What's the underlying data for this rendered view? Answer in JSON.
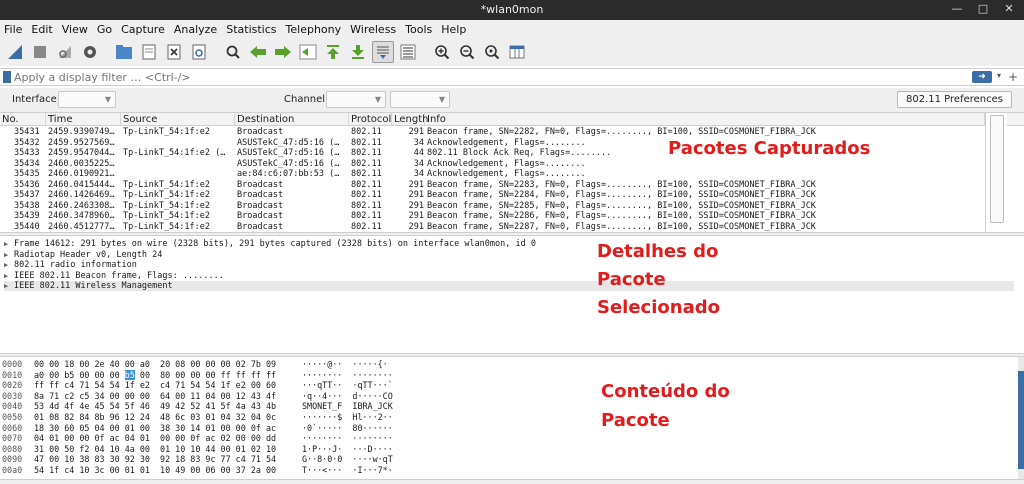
{
  "window": {
    "title": "*wlan0mon"
  },
  "window_controls": {
    "minimize": "—",
    "maximize": "□",
    "close": "✕"
  },
  "menu": [
    "File",
    "Edit",
    "View",
    "Go",
    "Capture",
    "Analyze",
    "Statistics",
    "Telephony",
    "Wireless",
    "Tools",
    "Help"
  ],
  "toolbar_icons": [
    "shark-fin-start-icon",
    "stop-icon",
    "restart-icon",
    "options-gear-icon",
    "open-folder-icon",
    "save-icon",
    "close-file-icon",
    "reload-icon",
    "find-icon",
    "back-arrow-icon",
    "forward-arrow-icon",
    "goto-packet-icon",
    "first-packet-icon",
    "last-packet-icon",
    "autoscroll-icon",
    "colorize-icon",
    "zoom-in-icon",
    "zoom-out-icon",
    "zoom-normal-icon",
    "resize-columns-icon"
  ],
  "filter": {
    "placeholder": "Apply a display filter … <Ctrl-/>",
    "value": ""
  },
  "wireless_toolbar": {
    "interface_label": "Interface",
    "channel_label": "Channel",
    "preferences_label": "802.11 Preferences"
  },
  "packet_list": {
    "columns": [
      "No.",
      "Time",
      "Source",
      "Destination",
      "Protocol",
      "Length",
      "Info"
    ],
    "rows": [
      [
        "35431",
        "2459.9390749…",
        "Tp-LinkT_54:1f:e2",
        "Broadcast",
        "802.11",
        "291",
        "Beacon frame, SN=2282, FN=0, Flags=........, BI=100, SSID=COSMONET_FIBRA_JCK"
      ],
      [
        "35432",
        "2459.9527569…",
        "",
        "ASUSTekC_47:d5:16 (…",
        "802.11",
        "34",
        "Acknowledgement, Flags=........"
      ],
      [
        "35433",
        "2459.9547044…",
        "Tp-LinkT_54:1f:e2 (…",
        "ASUSTekC_47:d5:16 (…",
        "802.11",
        "44",
        "802.11 Block Ack Req, Flags=........"
      ],
      [
        "35434",
        "2460.0035225…",
        "",
        "ASUSTekC_47:d5:16 (…",
        "802.11",
        "34",
        "Acknowledgement, Flags=........"
      ],
      [
        "35435",
        "2460.0190921…",
        "",
        "ae:84:c6:07:bb:53 (…",
        "802.11",
        "34",
        "Acknowledgement, Flags=........"
      ],
      [
        "35436",
        "2460.0415444…",
        "Tp-LinkT_54:1f:e2",
        "Broadcast",
        "802.11",
        "291",
        "Beacon frame, SN=2283, FN=0, Flags=........, BI=100, SSID=COSMONET_FIBRA_JCK"
      ],
      [
        "35437",
        "2460.1426469…",
        "Tp-LinkT_54:1f:e2",
        "Broadcast",
        "802.11",
        "291",
        "Beacon frame, SN=2284, FN=0, Flags=........, BI=100, SSID=COSMONET_FIBRA_JCK"
      ],
      [
        "35438",
        "2460.2463308…",
        "Tp-LinkT_54:1f:e2",
        "Broadcast",
        "802.11",
        "291",
        "Beacon frame, SN=2285, FN=0, Flags=........, BI=100, SSID=COSMONET_FIBRA_JCK"
      ],
      [
        "35439",
        "2460.3478960…",
        "Tp-LinkT_54:1f:e2",
        "Broadcast",
        "802.11",
        "291",
        "Beacon frame, SN=2286, FN=0, Flags=........, BI=100, SSID=COSMONET_FIBRA_JCK"
      ],
      [
        "35440",
        "2460.4512777…",
        "Tp-LinkT_54:1f:e2",
        "Broadcast",
        "802.11",
        "291",
        "Beacon frame, SN=2287, FN=0, Flags=........, BI=100, SSID=COSMONET_FIBRA_JCK"
      ]
    ]
  },
  "details": [
    "Frame 14612: 291 bytes on wire (2328 bits), 291 bytes captured (2328 bits) on interface wlan0mon, id 0",
    "Radiotap Header v0, Length 24",
    "802.11 radio information",
    "IEEE 802.11 Beacon frame, Flags: ........",
    "IEEE 802.11 Wireless Management"
  ],
  "bytes": [
    {
      "off": "0000",
      "hex": "00 00 18 00 2e 40 00 a0  20 08 00 00 00 02 7b 09",
      "ascii": "·····@··  ·····{·"
    },
    {
      "off": "0010",
      "hex": "a0 00 b5 00 00 00 b5 00  80 00 00 00 ff ff ff ff",
      "ascii": "········  ········"
    },
    {
      "off": "0020",
      "hex": "ff ff c4 71 54 54 1f e2  c4 71 54 54 1f e2 00 60",
      "ascii": "···qTT··  ·qTT···`"
    },
    {
      "off": "0030",
      "hex": "8a 71 c2 c5 34 00 00 00  64 00 11 04 00 12 43 4f",
      "ascii": "·q··4···  d·····CO"
    },
    {
      "off": "0040",
      "hex": "53 4d 4f 4e 45 54 5f 46  49 42 52 41 5f 4a 43 4b",
      "ascii": "SMONET_F  IBRA_JCK"
    },
    {
      "off": "0050",
      "hex": "01 08 82 84 8b 96 12 24  48 6c 03 01 04 32 04 0c",
      "ascii": "·······$  Hl···2··"
    },
    {
      "off": "0060",
      "hex": "18 30 60 05 04 00 01 00  38 30 14 01 00 00 0f ac",
      "ascii": "·0`·····  80······"
    },
    {
      "off": "0070",
      "hex": "04 01 00 00 0f ac 04 01  00 00 0f ac 02 00 00 dd",
      "ascii": "········  ········"
    },
    {
      "off": "0080",
      "hex": "31 00 50 f2 04 10 4a 00  01 10 10 44 00 01 02 10",
      "ascii": "1·P···J·  ···D····"
    },
    {
      "off": "0090",
      "hex": "47 00 10 38 83 30 92 30  92 18 83 9c 77 c4 71 54",
      "ascii": "G··8·0·0  ····w·qT"
    },
    {
      "off": "00a0",
      "hex": "54 1f c4 10 3c 00 01 01  10 49 00 06 00 37 2a 00",
      "ascii": "T···<···  ·I···7*·"
    }
  ],
  "annotations": {
    "captured": "Pacotes Capturados",
    "details_1": "Detalhes do",
    "details_2": "Pacote",
    "details_3": "Selecionado",
    "content_1": "Conteúdo do",
    "content_2": "Pacote"
  },
  "colors": {
    "annotation": "#e41b1b",
    "selection": "#3a8fd6",
    "accent": "#3a6ea5"
  }
}
